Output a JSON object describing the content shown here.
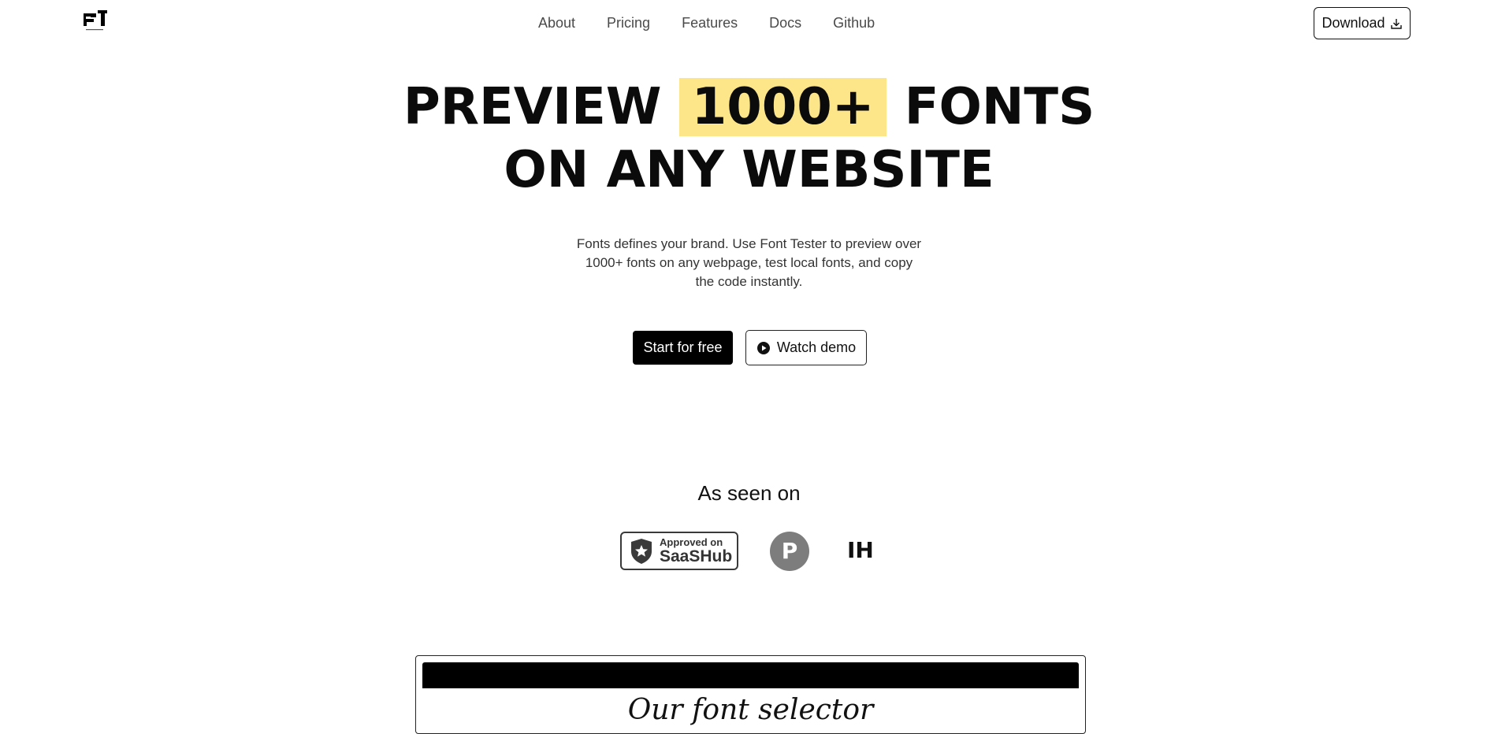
{
  "nav": {
    "items": [
      "About",
      "Pricing",
      "Features",
      "Docs",
      "Github"
    ]
  },
  "header": {
    "download_label": "Download"
  },
  "hero": {
    "title_line1_before": "PREVIEW",
    "title_highlight": "1000+",
    "title_line1_after": "FONTS",
    "title_line2": "ON ANY WEBSITE",
    "subtitle": "Fonts defines your brand. Use Font Tester to preview over 1000+ fonts on any webpage, test local fonts, and copy the code instantly.",
    "primary_cta": "Start for free",
    "secondary_cta": "Watch demo"
  },
  "seen_on": {
    "heading": "As seen on",
    "saashub_line1": "Approved on",
    "saashub_line2": "SaaSHub",
    "producthunt_letter": "P",
    "indiehackers_text": "IH"
  },
  "preview": {
    "text": "Our font selector"
  },
  "colors": {
    "highlight": "#fde68a",
    "primary": "#000000",
    "accent_gray": "#7d7d7d"
  }
}
